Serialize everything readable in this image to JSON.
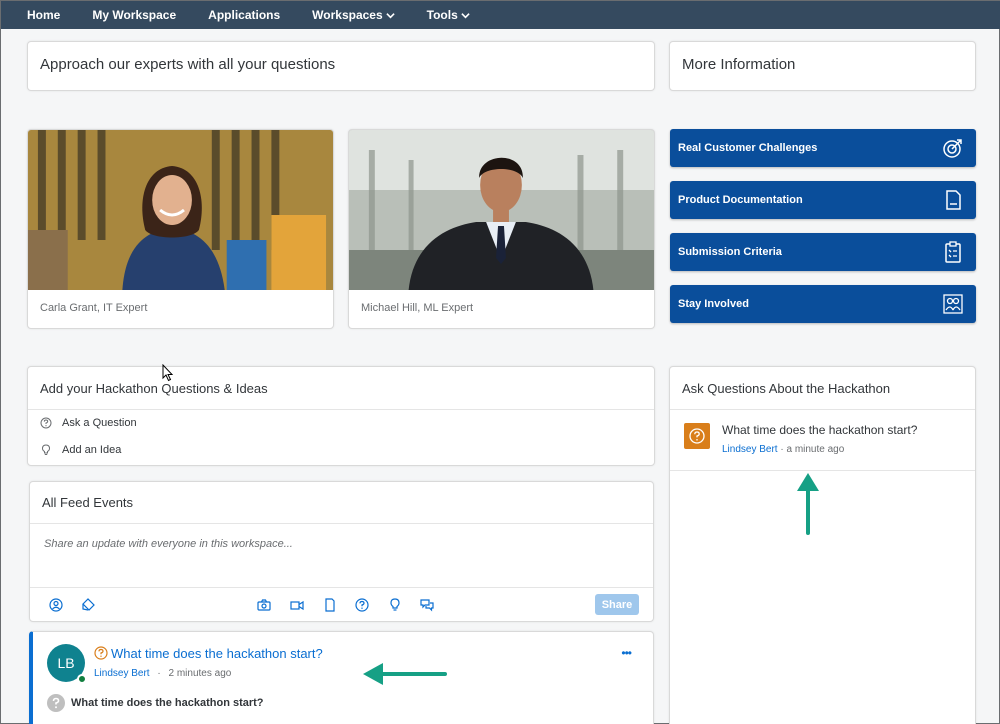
{
  "nav": {
    "items": [
      {
        "label": "Home"
      },
      {
        "label": "My Workspace"
      },
      {
        "label": "Applications"
      },
      {
        "label": "Workspaces",
        "dropdown": true
      },
      {
        "label": "Tools",
        "dropdown": true
      }
    ]
  },
  "header_left": {
    "title": "Approach our experts with all your questions"
  },
  "header_right": {
    "title": "More Information"
  },
  "experts": [
    {
      "caption": "Carla Grant, IT Expert"
    },
    {
      "caption": "Michael Hill, ML Expert"
    }
  ],
  "info_links": [
    {
      "label": "Real Customer Challenges",
      "icon": "target-icon"
    },
    {
      "label": "Product Documentation",
      "icon": "document-icon"
    },
    {
      "label": "Submission Criteria",
      "icon": "clipboard-icon"
    },
    {
      "label": "Stay Involved",
      "icon": "people-icon"
    }
  ],
  "ideas": {
    "title": "Add your Hackathon Questions & Ideas",
    "ask_question": "Ask a Question",
    "add_idea": "Add an Idea"
  },
  "feed": {
    "title": "All Feed Events",
    "placeholder": "Share an update with everyone in this workspace...",
    "share_label": "Share"
  },
  "feed_post": {
    "avatar_initials": "LB",
    "title": "What time does the hackathon start?",
    "author": "Lindsey Bert",
    "separator": "·",
    "time": "2 minutes ago",
    "body": "What time does the hackathon start?"
  },
  "questions": {
    "title": "Ask Questions About the Hackathon",
    "item": {
      "question": "What time does the hackathon start?",
      "author": "Lindsey Bert",
      "time": "· a minute ago"
    }
  },
  "colors": {
    "nav_bg": "#354a5f",
    "tile_bg": "#0a4e9b",
    "link": "#0a6ed1",
    "accent_orange": "#d97e1a",
    "annotation_arrow": "#16a085"
  }
}
